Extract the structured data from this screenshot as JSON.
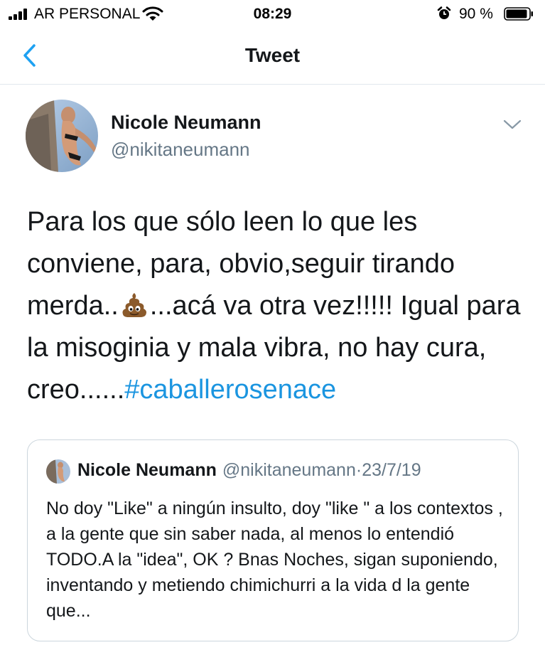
{
  "status_bar": {
    "carrier": "AR PERSONAL",
    "time": "08:29",
    "battery": "90 %",
    "icons": [
      "signal-bars-icon",
      "wifi-icon",
      "alarm-icon",
      "battery-icon"
    ]
  },
  "nav": {
    "title": "Tweet",
    "back_icon": "chevron-left-icon"
  },
  "tweet": {
    "author_name": "Nicole Neumann",
    "author_handle": "@nikitaneumann",
    "text_before_emoji": "Para los que sólo leen lo que les conviene, para, obvio,seguir tirando merda..",
    "emoji": "pile-of-poo-icon",
    "text_after_emoji": "...acá va otra vez!!!!! Igual para la misoginia y mala vibra, no hay cura, creo......",
    "hashtag": "#caballerosenace"
  },
  "quoted_tweet": {
    "author_name": "Nicole Neumann",
    "author_handle": "@nikitaneumann",
    "separator": "·",
    "date": "23/7/19",
    "text": "No doy \"Like\" a ningún insulto,  doy \"like \" a los contextos , a la gente que sin saber nada, al menos lo entendió TODO.A la \"idea\", OK ? Bnas Noches, sigan suponiendo, inventando y metiendo chimichurri a la vida d la gente que..."
  },
  "colors": {
    "link_blue": "#1b95e0",
    "nav_blue": "#1da1f2",
    "text_dark": "#14171a",
    "text_gray": "#657786",
    "border": "#ccd6dd"
  }
}
